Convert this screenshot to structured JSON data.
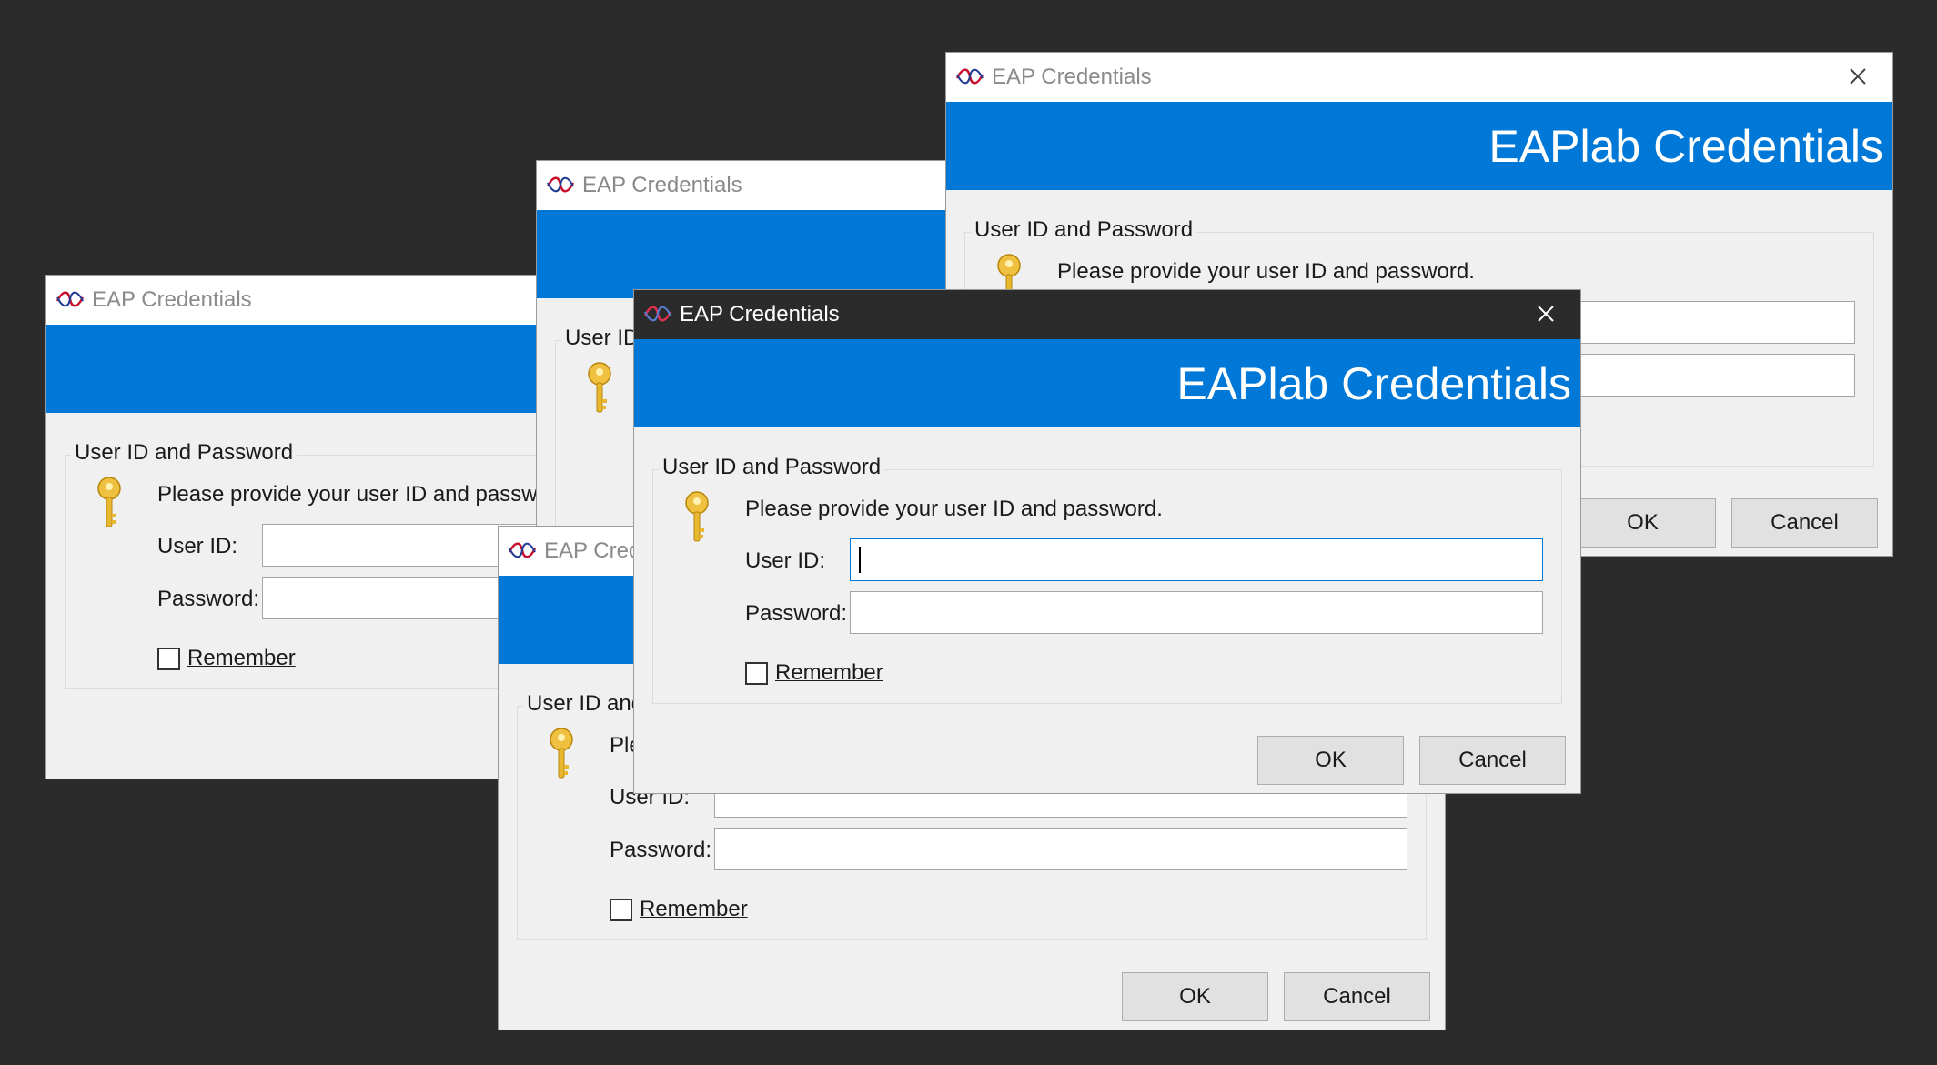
{
  "dialog": {
    "window_title": "EAP Credentials",
    "banner_title": "EAPlab Credentials",
    "group_legend": "User ID and Password",
    "prompt": "Please provide your user ID and password.",
    "user_id_label": "User ID:",
    "password_label": "Password:",
    "user_id_value": "",
    "password_value": "",
    "remember_label": "Remember",
    "remember_checked": false,
    "ok_label": "OK",
    "cancel_label": "Cancel"
  },
  "icons": [
    "eap-logo-icon",
    "close-icon",
    "key-icon"
  ],
  "colors": {
    "background": "#2b2b2b",
    "banner": "#0078d7",
    "dialog_body": "#f0f0f0",
    "active_titlebar": "#2b2b2b",
    "inactive_titlebar": "#ffffff",
    "button": "#e1e1e1"
  }
}
